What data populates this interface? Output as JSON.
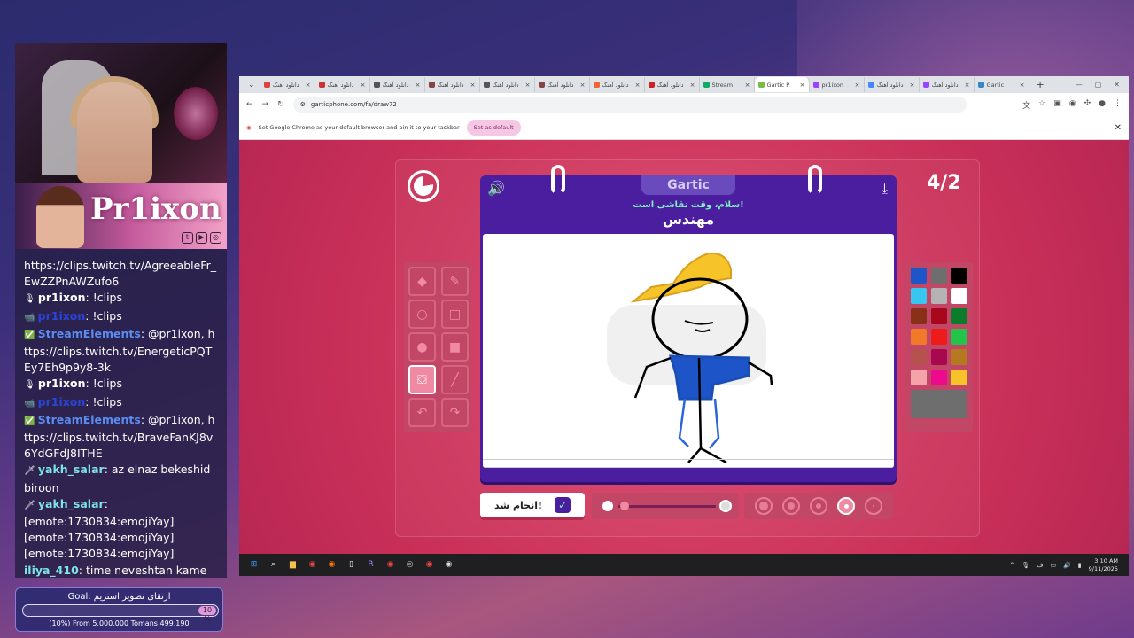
{
  "streamer": {
    "name": "Pr1ixon",
    "socials": [
      "twitch-icon",
      "youtube-icon",
      "instagram-icon"
    ]
  },
  "chat": [
    {
      "user": "",
      "text": "https://clips.twitch.tv/AgreeableFr_EwZZPnAWZufo6",
      "color": "#ffffff"
    },
    {
      "user": "pr1ixon",
      "text": ": !clips",
      "color": "#ffffff",
      "badge": "🎙"
    },
    {
      "user": "pr1ixon",
      "text": ": !clips",
      "color": "#2b44d8",
      "badge": "📹"
    },
    {
      "user": "StreamElements",
      "text": ": @pr1ixon, https://clips.twitch.tv/EnergeticPQTEy7Eh9p9y8-3k",
      "color": "#5b8cf0",
      "badge": "✅"
    },
    {
      "user": "pr1ixon",
      "text": ": !clips",
      "color": "#ffffff",
      "badge": "🎙"
    },
    {
      "user": "pr1ixon",
      "text": ": !clips",
      "color": "#2b44d8",
      "badge": "📹"
    },
    {
      "user": "StreamElements",
      "text": ": @pr1ixon, https://clips.twitch.tv/BraveFanKJ8v6YdGFdJ8ITHE",
      "color": "#5b8cf0",
      "badge": "✅"
    },
    {
      "user": "yakh_salar",
      "text": ": az elnaz bekeshid biroon",
      "color": "#7ee4e8",
      "badge": "🗡"
    },
    {
      "user": "yakh_salar",
      "text": ":",
      "color": "#7ee4e8",
      "badge": "🗡"
    },
    {
      "user": "",
      "text": "[emote:1730834:emojiYay]",
      "color": "#ffffff"
    },
    {
      "user": "",
      "text": "[emote:1730834:emojiYay]",
      "color": "#ffffff"
    },
    {
      "user": "",
      "text": "[emote:1730834:emojiYay]",
      "color": "#ffffff"
    },
    {
      "user": "iliya_410",
      "text": ": time neveshtan kame",
      "color": "#7ee4e8"
    }
  ],
  "goal": {
    "label": "Goal: ارتقای تصویر استریم",
    "percent": "10 %",
    "amount": "(10%) From 5,000,000 Tomans 499,190",
    "progress": 0.1
  },
  "browser": {
    "tabs": [
      {
        "title": "دانلود آهنگ",
        "fav": "#d44"
      },
      {
        "title": "دانلود آهنگ",
        "fav": "#c33"
      },
      {
        "title": "دانلود آهنگ",
        "fav": "#555"
      },
      {
        "title": "دانلود آهنگ",
        "fav": "#844"
      },
      {
        "title": "دانلود آهنگ",
        "fav": "#555"
      },
      {
        "title": "دانلود آهنگ",
        "fav": "#844"
      },
      {
        "title": "دانلود آهنگ",
        "fav": "#e63"
      },
      {
        "title": "دانلود آهنگ",
        "fav": "#c22"
      },
      {
        "title": "Stream",
        "fav": "#1a6"
      },
      {
        "title": "Gartic P",
        "fav": "#7b4",
        "active": true
      },
      {
        "title": "pr1ixon",
        "fav": "#94f"
      },
      {
        "title": "دانلود آهنگ",
        "fav": "#48f"
      },
      {
        "title": "دانلود آهنگ",
        "fav": "#94f"
      },
      {
        "title": "Gartic",
        "fav": "#38c"
      }
    ],
    "url": "garticphone.com/fa/draw72",
    "infobar_text": "Set Google Chrome as your default browser and pin it to your taskbar",
    "infobar_button": "Set as default"
  },
  "game": {
    "round": "4/2",
    "logo": "Gartic",
    "greeting": "سلام، وقت نقاشی است!",
    "word": "مهندس",
    "done_label": "انجام شد!",
    "tools": [
      "eraser-icon",
      "pencil-icon",
      "circle-outline-icon",
      "square-outline-icon",
      "circle-fill-icon",
      "square-fill-icon",
      "bucket-icon",
      "line-icon",
      "undo-icon",
      "redo-icon"
    ],
    "selected_tool": 6,
    "palette": [
      "#1e56c8",
      "#6e6e6e",
      "#000000",
      "#36c6f0",
      "#b4b4b4",
      "#ffffff",
      "#8a3016",
      "#a8081c",
      "#0a7c2a",
      "#f07a2a",
      "#ee1b1b",
      "#22c44a",
      "#b5524e",
      "#a8084e",
      "#b57a20",
      "#f4a4a8",
      "#ee0a8c",
      "#f6c428",
      "#6e6e6e"
    ]
  },
  "taskbar": {
    "apps": [
      "start-icon",
      "search-icon",
      "folder-icon",
      "chrome-icon",
      "firefox-icon",
      "file-icon",
      "r-app-icon",
      "game-icon",
      "steam-icon",
      "chrome-icon",
      "obs-icon"
    ],
    "time": "3:10 AM",
    "date": "9/11/2025"
  }
}
